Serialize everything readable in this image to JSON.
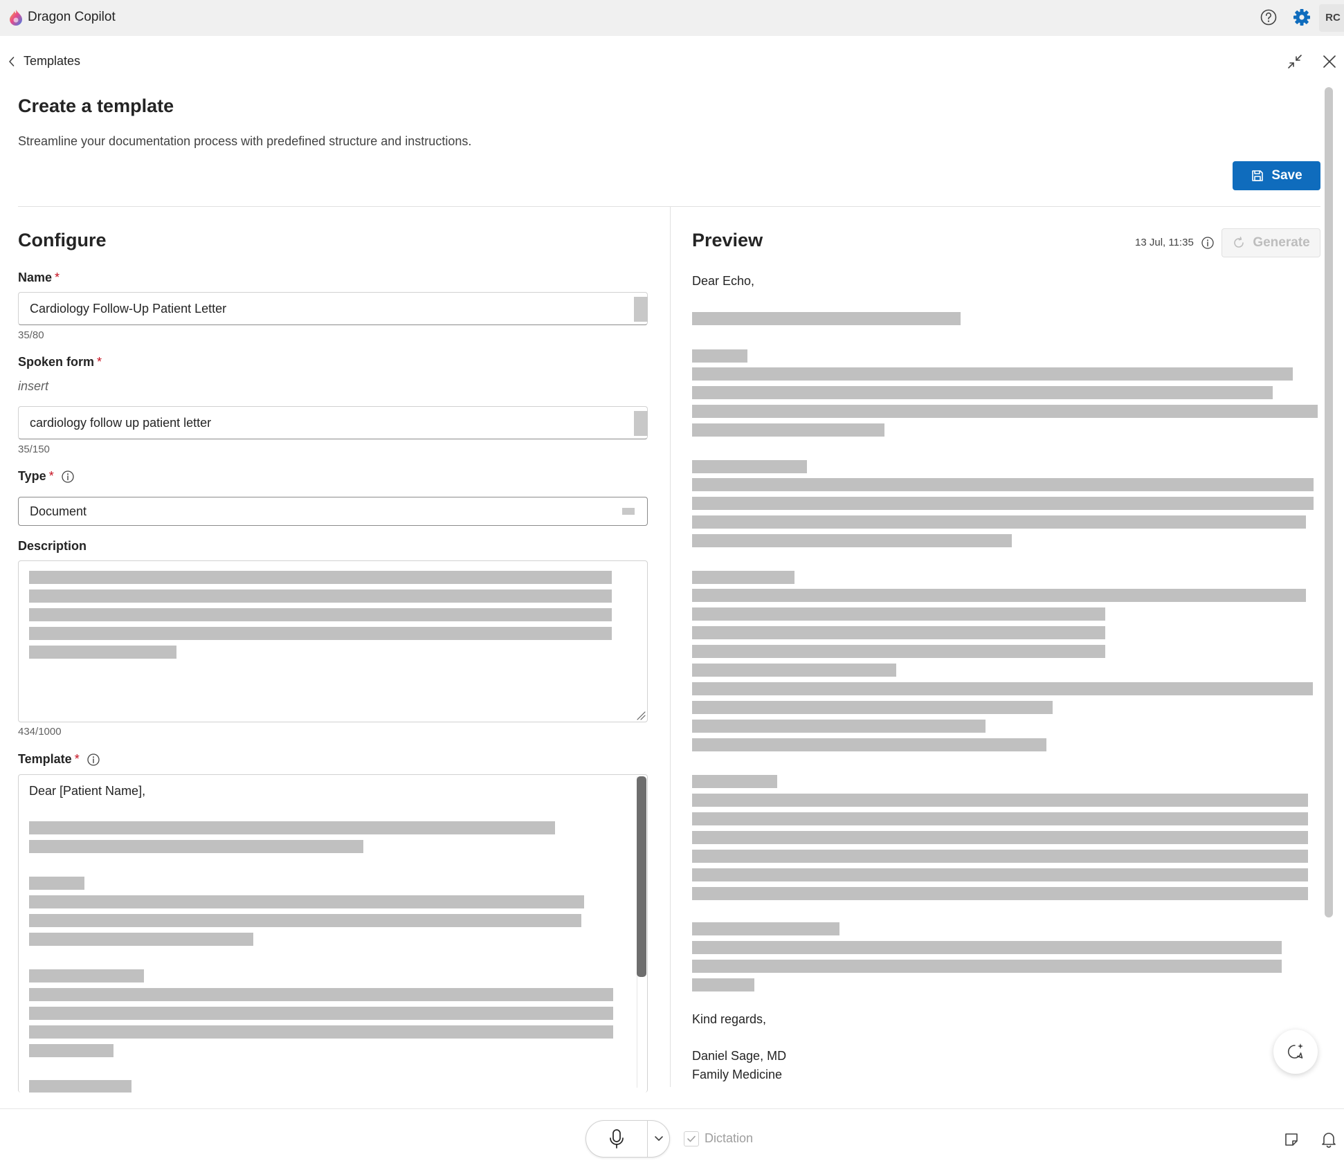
{
  "app": {
    "title": "Dragon Copilot",
    "avatar_initials": "RC",
    "accent_color": "#0f6cbd"
  },
  "breadcrumb": {
    "label": "Templates"
  },
  "header": {
    "title": "Create a template",
    "subtitle": "Streamline your documentation process with predefined structure and instructions.",
    "save_label": "Save"
  },
  "configure": {
    "title": "Configure",
    "name": {
      "label": "Name",
      "value": "Cardiology Follow-Up Patient Letter",
      "counter": "35/80"
    },
    "spoken_form": {
      "label": "Spoken form",
      "hint": "insert",
      "value": "cardiology follow up patient letter",
      "counter": "35/150"
    },
    "type": {
      "label": "Type",
      "value": "Document"
    },
    "description": {
      "label": "Description",
      "counter": "434/1000"
    },
    "template": {
      "label": "Template",
      "first_line": "Dear [Patient Name],"
    }
  },
  "preview": {
    "title": "Preview",
    "timestamp": "13 Jul, 11:35",
    "generate_label": "Generate",
    "greeting": "Dear Echo,",
    "closing": "Kind regards,",
    "signature_name": "Daniel Sage, MD",
    "signature_dept": "Family Medicine"
  },
  "bottom": {
    "dictation_label": "Dictation"
  }
}
